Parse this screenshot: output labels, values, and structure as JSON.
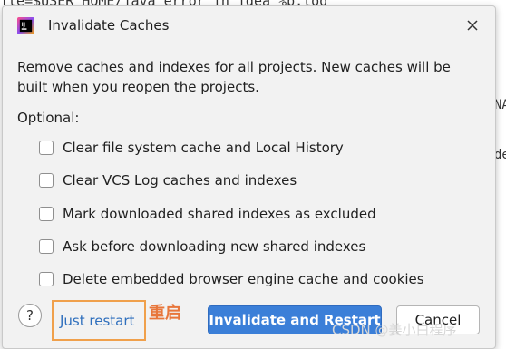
{
  "background": {
    "code_line": "ile=$USER_HOME/java_error_in_idea_%p.log",
    "right_fragments": [
      "NA",
      "de"
    ]
  },
  "dialog": {
    "title": "Invalidate Caches",
    "description": "Remove caches and indexes for all projects. New caches will be built when you reopen the projects.",
    "optional_label": "Optional:",
    "options": [
      {
        "label": "Clear file system cache and Local History",
        "checked": false
      },
      {
        "label": "Clear VCS Log caches and indexes",
        "checked": false
      },
      {
        "label": "Mark downloaded shared indexes as excluded",
        "checked": false
      },
      {
        "label": "Ask before downloading new shared indexes",
        "checked": false
      },
      {
        "label": "Delete embedded browser engine cache and cookies",
        "checked": false
      }
    ],
    "help_label": "?",
    "just_restart_label": "Just restart",
    "primary_button_label": "Invalidate and Restart",
    "cancel_button_label": "Cancel",
    "accent_color": "#3b7fd8"
  },
  "annotation": {
    "text": "重启",
    "color": "#e8763b"
  },
  "watermark": {
    "text": "CSDN @姜小白程序"
  }
}
